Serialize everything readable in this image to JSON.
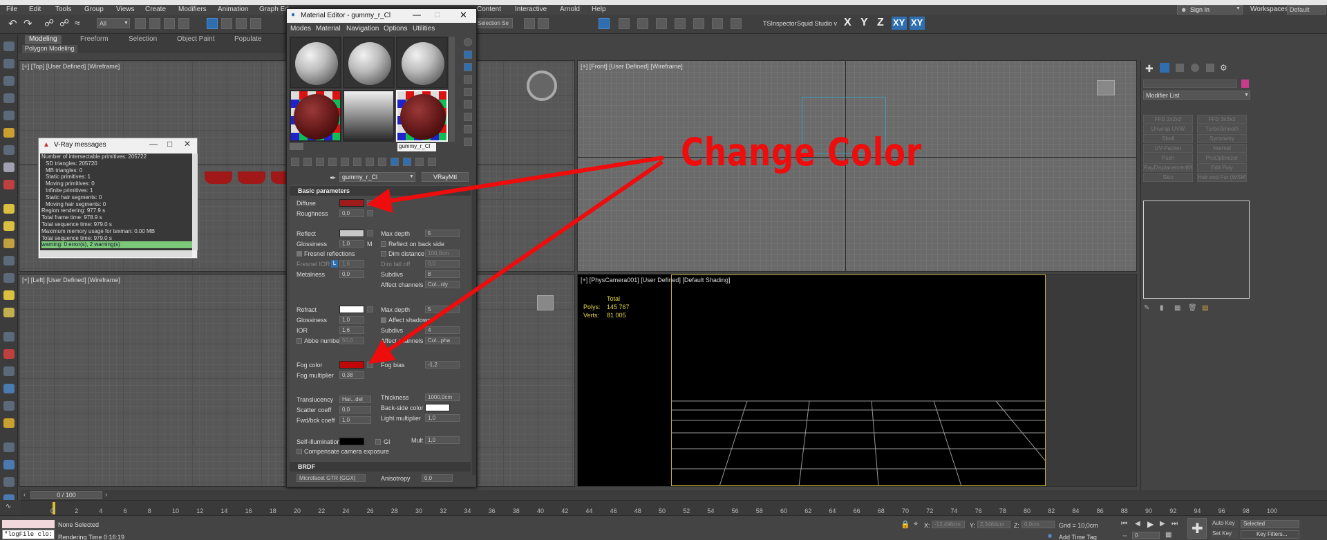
{
  "menu": [
    "File",
    "Edit",
    "Tools",
    "Group",
    "Views",
    "Create",
    "Modifiers",
    "Animation",
    "Graph Ed",
    "Content",
    "Interactive",
    "Arnold",
    "Help"
  ],
  "account": {
    "sign_in": "Sign In",
    "workspaces_label": "Workspaces:",
    "workspace": "Default"
  },
  "toolbar": {
    "filter": "All",
    "selection_set": "Selection Se",
    "ts_inspector": "TSInspector",
    "squid": "Squid Studio v",
    "axes": [
      "X",
      "Y",
      "Z",
      "XY",
      "XY"
    ]
  },
  "ribbon": {
    "tabs": [
      "Modeling",
      "Freeform",
      "Selection",
      "Object Paint",
      "Populate"
    ],
    "sub": "Polygon Modeling"
  },
  "viewports": {
    "top": "[+] [Top] [User Defined] [Wireframe]",
    "front": "[+] [Front] [User Defined] [Wireframe]",
    "left": "[+] [Left] [User Defined] [Wireframe]",
    "camera": "[+] [PhysCamera001] [User Defined] [Default Shading]",
    "stats": {
      "total_label": "Total",
      "polys_label": "Polys:",
      "polys": "145 767",
      "verts_label": "Verts:",
      "verts": "81 005"
    }
  },
  "vray": {
    "title": "V-Ray messages",
    "lines": [
      "Number of intersectable primitives: 205722",
      "SD triangles: 205720",
      "MB triangles: 0",
      "Static primitives: 1",
      "Moving primitives: 0",
      "Infinite primitives: 1",
      "Static hair segments: 0",
      "Moving hair segments: 0",
      "Region rendering: 977.9 s",
      "Total frame time: 978.9 s",
      "Total sequence time: 979.0 s",
      "Maximum memory usage for texman: 0.00 MB",
      "Total sequence time: 979.0 s"
    ],
    "warning": "warning: 0 error(s), 2 warning(s)",
    "sep": "=================================="
  },
  "material_editor": {
    "title": "Material Editor - gummy_r_Cl",
    "menu": [
      "Modes",
      "Material",
      "Navigation",
      "Options",
      "Utilities"
    ],
    "tooltip": "gummy_r_Cl",
    "material_name": "gummy_r_Cl",
    "material_type": "VRayMtl",
    "basic_header": "Basic parameters",
    "brdf_header": "BRDF",
    "diffuse": {
      "label": "Diffuse",
      "color": "#9e1c1c"
    },
    "roughness": {
      "label": "Roughness",
      "value": "0,0"
    },
    "reflect": {
      "label": "Reflect",
      "color": "#c8c8c8"
    },
    "glossiness": {
      "label": "Glossiness",
      "value": "1,0",
      "map": "M"
    },
    "fresnel": "Fresnel reflections",
    "fresnel_ior": {
      "label": "Fresnel IOR",
      "lock": "L",
      "value": "1,6"
    },
    "metalness": {
      "label": "Metalness",
      "value": "0,0"
    },
    "max_depth": {
      "label": "Max depth",
      "value": "5"
    },
    "reflect_back": "Reflect on back side",
    "dim_distance": {
      "label": "Dim distance",
      "value": "100,0cm"
    },
    "dim_falloff": {
      "label": "Dim fall off",
      "value": "0,0"
    },
    "subdivs": {
      "label": "Subdivs",
      "value": "8"
    },
    "affect_channels": {
      "label": "Affect channels",
      "value": "Col...nly"
    },
    "refract": {
      "label": "Refract",
      "color": "#ffffff"
    },
    "r_glossiness": {
      "label": "Glossiness",
      "value": "1,0"
    },
    "ior": {
      "label": "IOR",
      "value": "1,6"
    },
    "abbe": {
      "label": "Abbe number",
      "value": "50,0"
    },
    "r_max_depth": {
      "label": "Max depth",
      "value": "5"
    },
    "affect_shadows": "Affect shadows",
    "r_subdivs": {
      "label": "Subdivs",
      "value": "4"
    },
    "r_affect": {
      "label": "Affect channels",
      "value": "Col...pha"
    },
    "fog_color": {
      "label": "Fog color",
      "color": "#c00808"
    },
    "fog_mult": {
      "label": "Fog multiplier",
      "value": "0,38"
    },
    "fog_bias": {
      "label": "Fog bias",
      "value": "-1,2"
    },
    "translucency": {
      "label": "Translucency",
      "value": "Har...del"
    },
    "scatter": {
      "label": "Scatter coeff",
      "value": "0,0"
    },
    "fwd": {
      "label": "Fwd/bck coeff",
      "value": "1,0"
    },
    "thickness": {
      "label": "Thickness",
      "value": "1000,0cm"
    },
    "backside": {
      "label": "Back-side color",
      "color": "#ffffff"
    },
    "light_mult": {
      "label": "Light multiplier",
      "value": "1,0"
    },
    "selfillum": {
      "label": "Self-illumination",
      "color": "#000000",
      "gi": "GI",
      "mult_label": "Mult",
      "mult": "1,0"
    },
    "compensate": "Compensate camera exposure",
    "brdf_type": "Microfacet GTR (GGX)",
    "anisotropy": {
      "label": "Anisotropy",
      "value": "0,0"
    }
  },
  "command_panel": {
    "modifier_list": "Modifier List",
    "buttons": [
      "FFD 2x2x2",
      "FFD 3x3x3",
      "Unwrap UVW",
      "TurboSmooth",
      "Shell",
      "Symmetry",
      "UV-Packer",
      "Normal",
      "Push",
      "ProOptimizer",
      "RayDisplacementMo",
      "Edit Poly",
      "Skin",
      "Hair and Fur (WSM)"
    ]
  },
  "timeline": {
    "frame": "0 / 100",
    "ticks": [
      "0",
      "2",
      "4",
      "6",
      "8",
      "10",
      "12",
      "14",
      "16",
      "18",
      "20",
      "22",
      "24",
      "26",
      "28",
      "30",
      "32",
      "34",
      "36",
      "38",
      "40",
      "42",
      "44",
      "46",
      "48",
      "50",
      "52",
      "54",
      "56",
      "58",
      "60",
      "62",
      "64",
      "66",
      "68",
      "70",
      "72",
      "74",
      "76",
      "78",
      "80",
      "82",
      "84",
      "86",
      "88",
      "90",
      "92",
      "94",
      "96",
      "98",
      "100"
    ]
  },
  "status": {
    "maxscript": "\"logFile clo:",
    "none_selected": "None Selected",
    "render_time": "Rendering Time  0:16:19",
    "x_label": "X:",
    "x": "-12,496cm",
    "y_label": "Y:",
    "y": "2,3464cm",
    "z_label": "Z:",
    "z": "0,0cm",
    "grid": "Grid = 10,0cm",
    "add_time_tag": "Add Time Tag",
    "auto_key": "Auto Key",
    "set_key": "Set Key",
    "selected": "Selected",
    "key_filters": "Key Filters...",
    "frame": "0"
  },
  "annotation": {
    "text": "Change Color",
    "color": "#ee0c0c"
  }
}
